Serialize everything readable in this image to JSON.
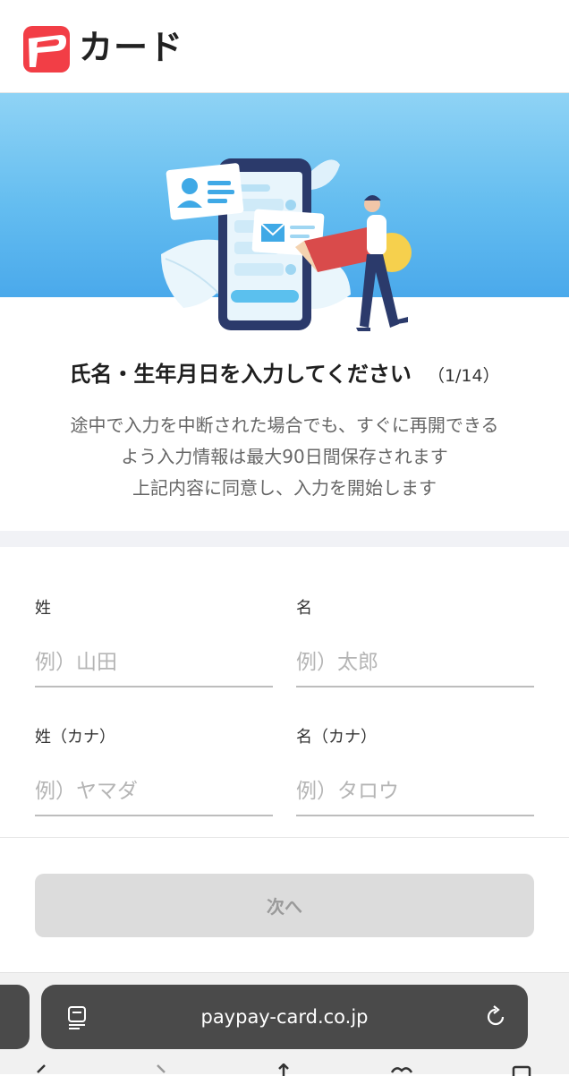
{
  "header": {
    "logo_mark": "P",
    "logo_text": "カード"
  },
  "intro": {
    "title": "氏名・生年月日を入力してください",
    "step": "（1/14）",
    "description": [
      "途中で入力を中断された場合でも、すぐに再開できる",
      "よう入力情報は最大90日間保存されます",
      "上記内容に同意し、入力を開始します"
    ]
  },
  "form": {
    "last_name": {
      "label": "姓",
      "placeholder": "例）山田",
      "value": ""
    },
    "first_name": {
      "label": "名",
      "placeholder": "例）太郎",
      "value": ""
    },
    "last_name_kana": {
      "label": "姓（カナ）",
      "placeholder": "例）ヤマダ",
      "value": ""
    },
    "first_name_kana": {
      "label": "名（カナ）",
      "placeholder": "例）タロウ",
      "value": ""
    },
    "next_label": "次へ"
  },
  "browser": {
    "url": "paypay-card.co.jp",
    "icons": [
      "reader-icon",
      "reload-icon"
    ]
  },
  "colors": {
    "brand_red": "#f23e46",
    "hero_blue": "#64bdf0",
    "disabled_button": "#dcdcdc",
    "url_bar": "#4a4a4a"
  }
}
